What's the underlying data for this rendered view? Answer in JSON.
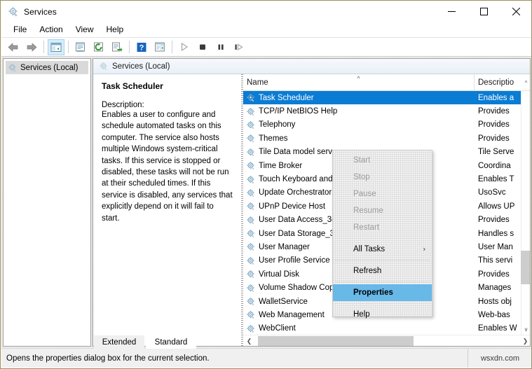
{
  "window": {
    "title": "Services",
    "icon": "services-gear-icon",
    "controls": {
      "minimize": "minimize-icon",
      "maximize": "maximize-icon",
      "close": "close-icon"
    }
  },
  "menubar": {
    "items": [
      {
        "label": "File"
      },
      {
        "label": "Action"
      },
      {
        "label": "View"
      },
      {
        "label": "Help"
      }
    ]
  },
  "toolbar": {
    "buttons": [
      {
        "name": "back-button",
        "icon": "arrow-left-icon"
      },
      {
        "name": "forward-button",
        "icon": "arrow-right-icon"
      },
      {
        "name": "show-hide-console-tree-button",
        "icon": "console-tree-icon"
      },
      {
        "name": "properties-button",
        "icon": "properties-icon"
      },
      {
        "name": "refresh-button",
        "icon": "refresh-icon"
      },
      {
        "name": "export-list-button",
        "icon": "export-list-icon"
      },
      {
        "name": "help-button",
        "icon": "help-icon"
      },
      {
        "name": "show-action-pane-button",
        "icon": "action-pane-icon"
      },
      {
        "name": "start-service-button",
        "icon": "play-icon"
      },
      {
        "name": "stop-service-button",
        "icon": "stop-icon"
      },
      {
        "name": "pause-service-button",
        "icon": "pause-icon"
      },
      {
        "name": "restart-service-button",
        "icon": "restart-icon"
      }
    ]
  },
  "tree": {
    "root": {
      "label": "Services (Local)",
      "icon": "services-gear-icon"
    }
  },
  "content": {
    "header": {
      "label": "Services (Local)",
      "icon": "services-gear-icon"
    },
    "detail": {
      "title": "Task Scheduler",
      "description_label": "Description:",
      "description": "Enables a user to configure and schedule automated tasks on this computer. The service also hosts multiple Windows system-critical tasks. If this service is stopped or disabled, these tasks will not be run at their scheduled times. If this service is disabled, any services that explicitly depend on it will fail to start."
    },
    "list": {
      "columns": [
        {
          "label": "Name",
          "sort": "ascending"
        },
        {
          "label": "Descriptio"
        }
      ],
      "rows": [
        {
          "name": "Task Scheduler",
          "description": "Enables a",
          "selected": true
        },
        {
          "name": "TCP/IP NetBIOS Help",
          "description": "Provides",
          "selected": false
        },
        {
          "name": "Telephony",
          "description": "Provides",
          "selected": false
        },
        {
          "name": "Themes",
          "description": "Provides",
          "selected": false
        },
        {
          "name": "Tile Data model serv",
          "description": "Tile Serve",
          "selected": false
        },
        {
          "name": "Time Broker",
          "description": "Coordina",
          "selected": false
        },
        {
          "name": "Touch Keyboard and",
          "description": "Enables T",
          "selected": false
        },
        {
          "name": "Update Orchestrator",
          "description": "UsoSvc",
          "selected": false
        },
        {
          "name": "UPnP Device Host",
          "description": "Allows UP",
          "selected": false
        },
        {
          "name": "User Data Access_3c",
          "description": "Provides",
          "selected": false
        },
        {
          "name": "User Data Storage_3",
          "description": "Handles s",
          "selected": false
        },
        {
          "name": "User Manager",
          "description": "User Man",
          "selected": false
        },
        {
          "name": "User Profile Service",
          "description": "This servi",
          "selected": false
        },
        {
          "name": "Virtual Disk",
          "description": "Provides",
          "selected": false
        },
        {
          "name": "Volume Shadow Copy",
          "description": "Manages",
          "selected": false
        },
        {
          "name": "WalletService",
          "description": "Hosts obj",
          "selected": false
        },
        {
          "name": "Web Management",
          "description": "Web-bas",
          "selected": false
        },
        {
          "name": "WebClient",
          "description": "Enables W",
          "selected": false
        }
      ]
    }
  },
  "context_menu": {
    "items": [
      {
        "label": "Start",
        "state": "disabled",
        "separator_after": false
      },
      {
        "label": "Stop",
        "state": "disabled",
        "separator_after": false
      },
      {
        "label": "Pause",
        "state": "disabled",
        "separator_after": false
      },
      {
        "label": "Resume",
        "state": "disabled",
        "separator_after": false
      },
      {
        "label": "Restart",
        "state": "disabled",
        "separator_after": true
      },
      {
        "label": "All Tasks",
        "state": "normal",
        "submenu": true,
        "separator_after": true
      },
      {
        "label": "Refresh",
        "state": "normal",
        "separator_after": true
      },
      {
        "label": "Properties",
        "state": "highlighted",
        "separator_after": true
      },
      {
        "label": "Help",
        "state": "normal",
        "separator_after": false
      }
    ]
  },
  "tabs": [
    {
      "label": "Extended",
      "active": false
    },
    {
      "label": "Standard",
      "active": true
    }
  ],
  "statusbar": {
    "text": "Opens the properties dialog box for the current selection.",
    "watermark": "wsxdn.com"
  },
  "colors": {
    "selection_blue": "#0a7cd4",
    "menu_highlight": "#68b8e8",
    "window_border": "#9c8f5e",
    "toolbar_pressed": "#d7ecfb"
  }
}
